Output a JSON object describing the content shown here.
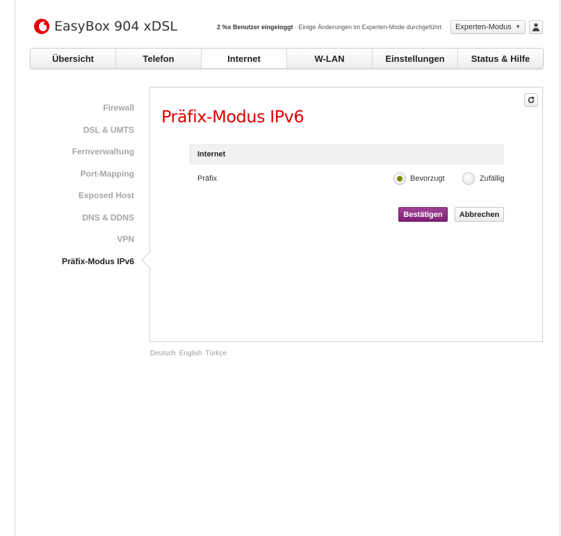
{
  "header": {
    "brand": "EasyBox 904 xDSL",
    "status_prefix": "2 %s Benutzer eingeloggt",
    "status_suffix": " · Einige Änderungen im Experten-Mode durchgeführt",
    "mode_select": "Experten-Modus"
  },
  "tabs": [
    {
      "label": "Übersicht"
    },
    {
      "label": "Telefon"
    },
    {
      "label": "Internet"
    },
    {
      "label": "W-LAN"
    },
    {
      "label": "Einstellungen"
    },
    {
      "label": "Status & Hilfe"
    }
  ],
  "sidebar": {
    "items": [
      {
        "label": "Firewall"
      },
      {
        "label": "DSL & UMTS"
      },
      {
        "label": "Fernverwaltung"
      },
      {
        "label": "Port-Mapping"
      },
      {
        "label": "Exposed Host"
      },
      {
        "label": "DNS & DDNS"
      },
      {
        "label": "VPN"
      },
      {
        "label": "Präfix-Modus IPv6"
      }
    ]
  },
  "main": {
    "title": "Präfix-Modus IPv6",
    "section_title": "Internet",
    "field_label": "Präfix",
    "options": [
      {
        "label": "Bevorzugt",
        "checked": true
      },
      {
        "label": "Zufällig",
        "checked": false
      }
    ],
    "confirm_label": "Bestätigen",
    "cancel_label": "Abbrechen"
  },
  "footer": {
    "languages": [
      "Deutsch",
      "English",
      "Türkçe"
    ]
  },
  "colors": {
    "brand_red": "#e20000",
    "primary_button": "#8c2b82",
    "radio_checked": "#7f8a00",
    "inactive_nav": "#a6a6a6"
  },
  "icons": [
    "vodafone-logo-icon",
    "user-icon",
    "chevron-down-icon",
    "refresh-icon"
  ]
}
